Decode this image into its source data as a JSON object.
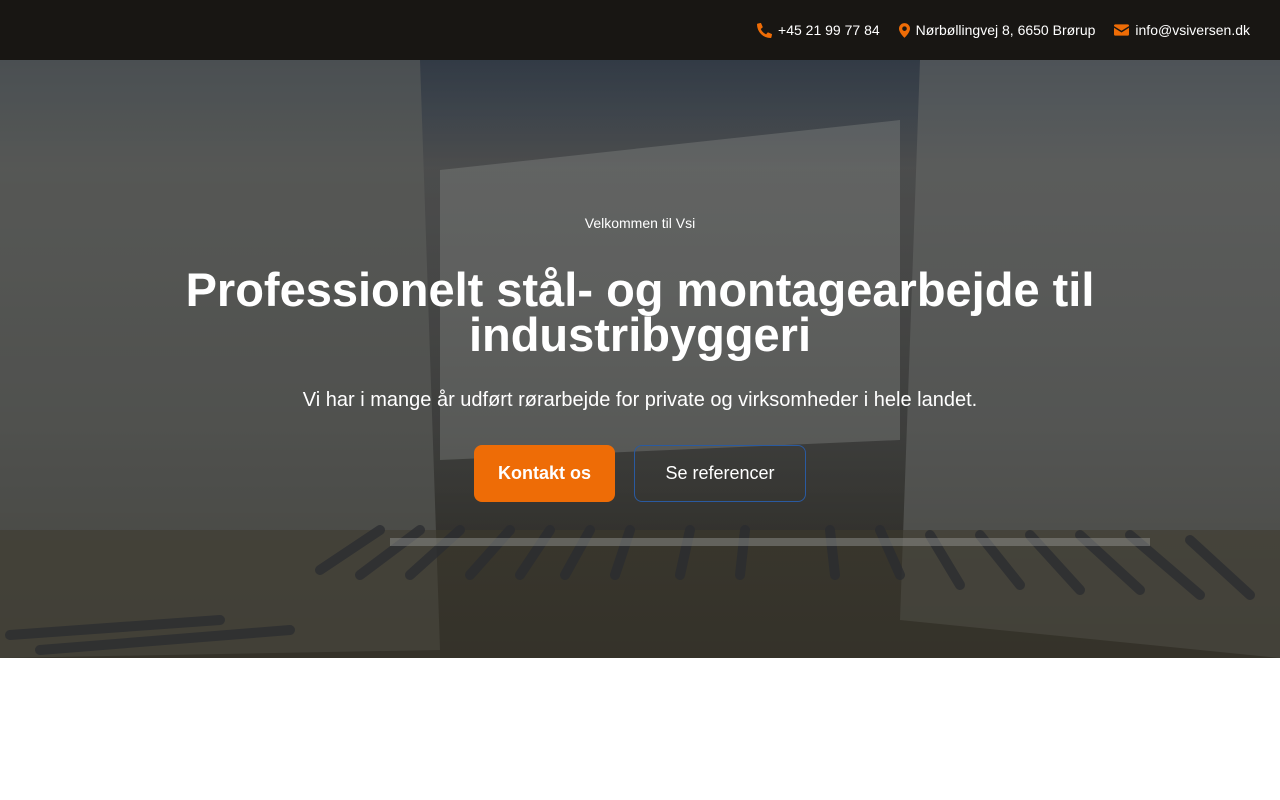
{
  "topbar": {
    "phone": "+45 21 99 77 84",
    "address": "Nørbøllingvej 8, 6650 Brørup",
    "email": "info@vsiversen.dk"
  },
  "hero": {
    "eyebrow": "Velkommen til Vsi",
    "headline": "Professionelt stål- og montagearbejde til industribyggeri",
    "subline": "Vi har i mange år udført rørarbejde for private og virksomheder i hele landet.",
    "primary_cta": "Kontakt os",
    "secondary_cta": "Se referencer"
  },
  "colors": {
    "accent": "#ee6c06",
    "topbar_bg": "#181613",
    "secondary_border": "#2a5aa0"
  },
  "icons": {
    "phone": "phone-icon",
    "address": "map-marker-icon",
    "email": "envelope-icon"
  }
}
